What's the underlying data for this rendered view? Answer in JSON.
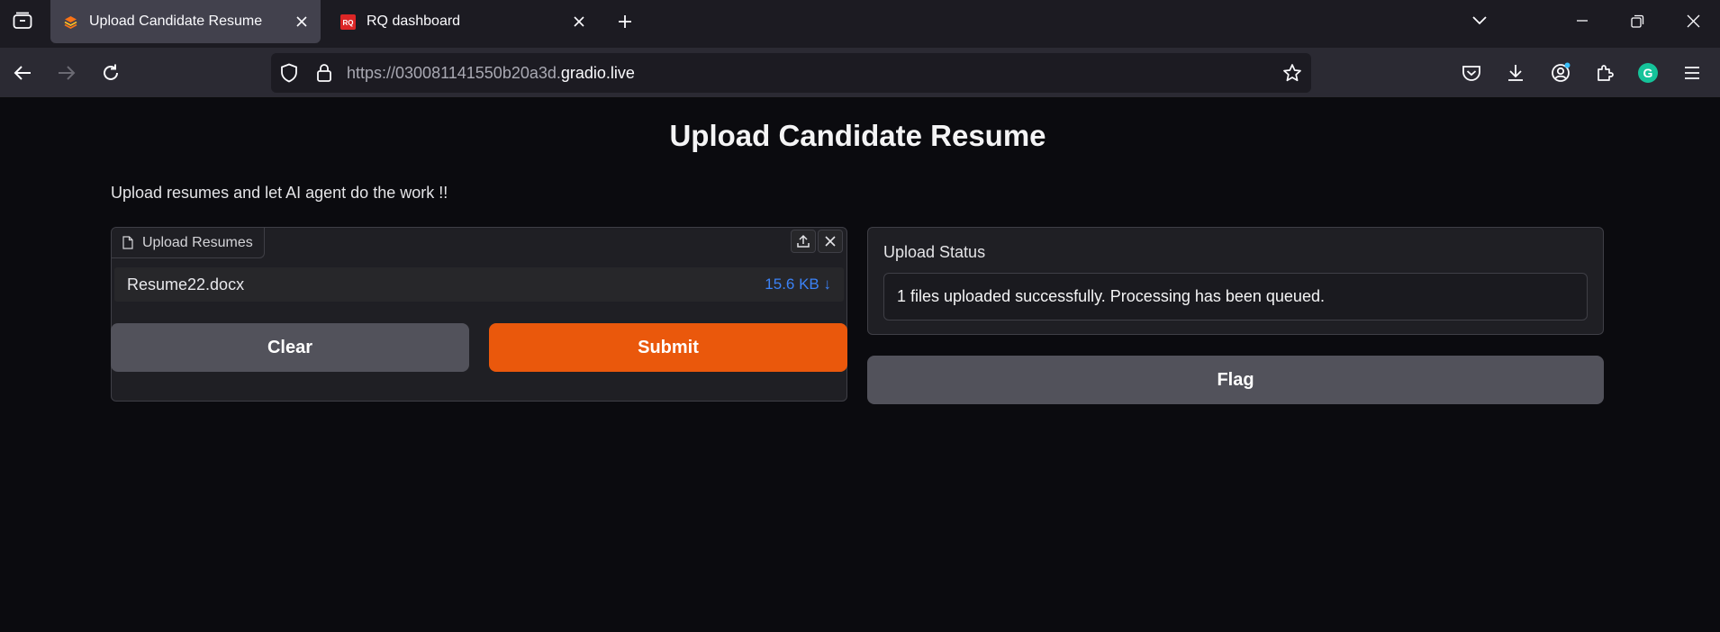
{
  "browser": {
    "tabs": [
      {
        "title": "Upload Candidate Resume",
        "active": true,
        "favicon": "gradio-logo"
      },
      {
        "title": "RQ dashboard",
        "active": false,
        "favicon": "RQ"
      }
    ],
    "url": {
      "prefix": "https://030081141550b20a3d.",
      "host": "gradio.live"
    }
  },
  "page": {
    "title": "Upload Candidate Resume",
    "description": "Upload resumes and let AI agent do the work !!",
    "file_input": {
      "label": "Upload Resumes",
      "files": [
        {
          "name": "Resume22.docx",
          "size": "15.6 KB ↓"
        }
      ]
    },
    "buttons": {
      "clear": "Clear",
      "submit": "Submit",
      "flag": "Flag"
    },
    "status": {
      "label": "Upload Status",
      "value": "1 files uploaded successfully. Processing has been queued."
    }
  },
  "colors": {
    "accent": "#ea580c",
    "secondary_button": "#52525b",
    "link": "#3b82f6",
    "background": "#0b0b0f"
  }
}
